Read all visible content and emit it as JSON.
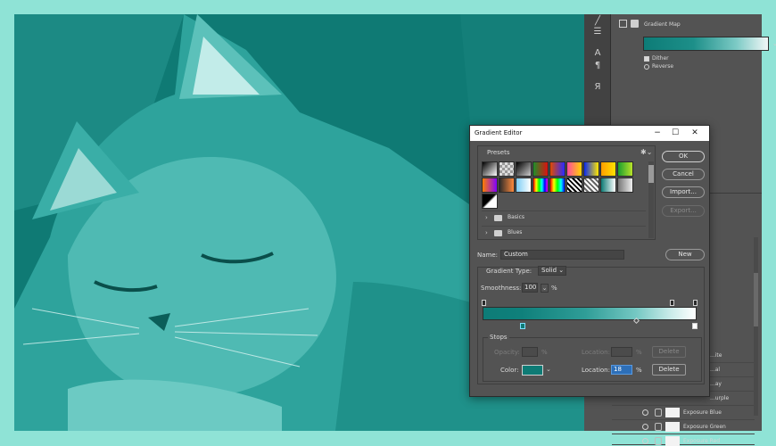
{
  "colors": {
    "frame": "#8fe3d6",
    "teal": "#0e7b75",
    "panel": "#535353",
    "dark": "#2b2b2b"
  },
  "properties_panel": {
    "title": "Gradient Map",
    "dither_label": "Dither",
    "dither_checked": true,
    "reverse_label": "Reverse",
    "reverse_checked": false
  },
  "tool_icons": [
    "brush-tool-icon",
    "sliders-icon",
    "character-icon",
    "paragraph-icon",
    "glyph-icon"
  ],
  "layers": [
    {
      "name": "...ite"
    },
    {
      "name": "...al"
    },
    {
      "name": "...ay"
    },
    {
      "name": "...urple"
    },
    {
      "name": "Exposure Blue"
    },
    {
      "name": "Exposure Green"
    },
    {
      "name": "Exposure Red"
    }
  ],
  "dialog": {
    "title": "Gradient Editor",
    "presets_label": "Presets",
    "preset_swatches": [
      "linear-gradient(135deg,#000,#fff)",
      "repeating-conic-gradient(#999 0 25%,#ddd 0 50%) 0 0/6px 6px",
      "linear-gradient(135deg,#000,#ccc)",
      "linear-gradient(90deg,#1e8f2a,#d11)",
      "linear-gradient(90deg,#e04a00,#2a2aff)",
      "linear-gradient(90deg,#ff4aa0,#ffd300)",
      "linear-gradient(90deg,#0a2af0,#ffe800)",
      "linear-gradient(90deg,#ff9d00,#ffe200)",
      "linear-gradient(90deg,#1a9e2e,#b8e32a)",
      "linear-gradient(90deg,#ff7f00,#8000ff)",
      "linear-gradient(90deg,#2a2a2a,#ff8a3d)",
      "linear-gradient(90deg,#7dcdf5,#ffffff)",
      "linear-gradient(90deg,#ff0000,#ffff00,#00ff00,#00ffff,#0000ff,#ff00ff)",
      "linear-gradient(90deg,#ff0000,#ffff00,#00ff00,#00ffff,#0000ff)",
      "repeating-linear-gradient(45deg,#fff 0 2px,#000 2px 4px)",
      "repeating-linear-gradient(45deg,#fff 0 2px,#666 2px 4px)",
      "linear-gradient(90deg,#0e7b75,#ffffff)",
      "linear-gradient(90deg,#777,#eee)",
      "linear-gradient(135deg,#000 0 45%,#fff 55%)"
    ],
    "folders": [
      {
        "label": "Basics"
      },
      {
        "label": "Blues"
      }
    ],
    "buttons": {
      "ok": "OK",
      "cancel": "Cancel",
      "import": "Import...",
      "export": "Export...",
      "new": "New",
      "delete_opacity": "Delete",
      "delete_color": "Delete"
    },
    "name_label": "Name:",
    "name_value": "Custom",
    "gradient_type_label": "Gradient Type:",
    "gradient_type_value": "Solid",
    "smoothness_label": "Smoothness:",
    "smoothness_value": "100",
    "percent": "%",
    "stops": {
      "label": "Stops",
      "opacity_label": "Opacity:",
      "opacity_value": "",
      "opacity_location_label": "Location:",
      "opacity_location_value": "",
      "color_label": "Color:",
      "color_value": "#0e7b75",
      "color_location_label": "Location:",
      "color_location_value": "18"
    }
  }
}
